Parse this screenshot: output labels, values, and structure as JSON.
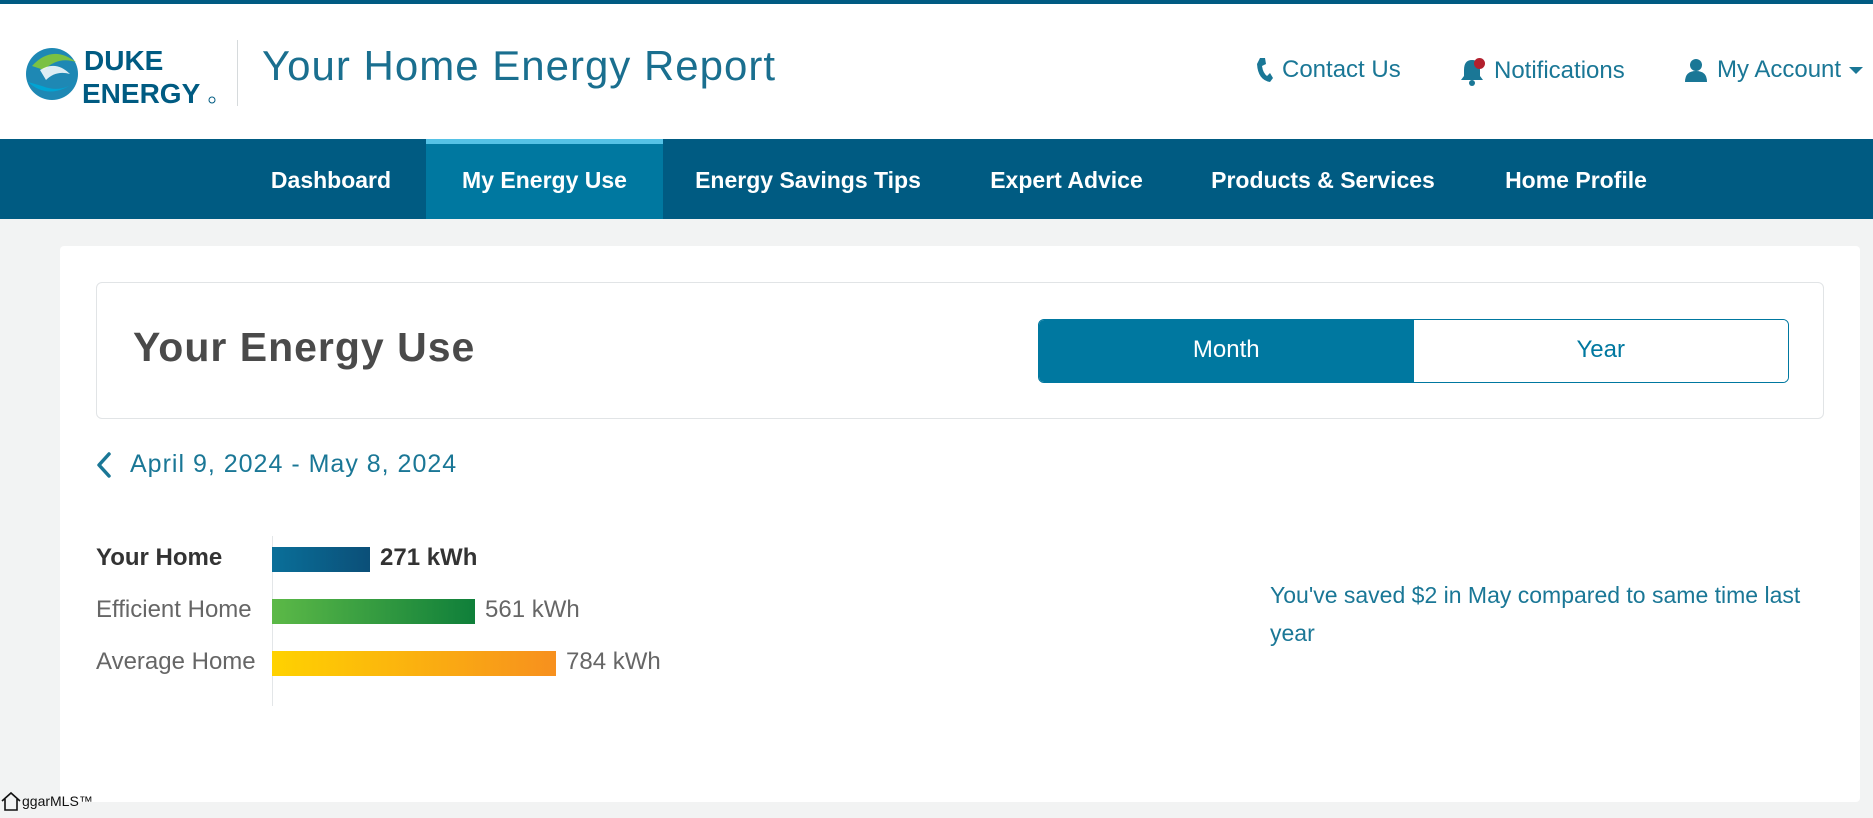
{
  "brand": {
    "logo_line1": "DUKE",
    "logo_line2": "ENERGY",
    "colors": {
      "primary": "#005b82",
      "accent": "#0078a0",
      "highlight": "#55c2e6",
      "efficient": "#1f9a47",
      "average": "#f7a11a",
      "notification": "#b3202e"
    }
  },
  "header": {
    "title": "Your Home Energy Report",
    "contact_label": "Contact Us",
    "notifications_label": "Notifications",
    "account_label": "My Account"
  },
  "nav": {
    "items": [
      {
        "label": "Dashboard"
      },
      {
        "label": "My Energy Use"
      },
      {
        "label": "Energy Savings Tips"
      },
      {
        "label": "Expert Advice"
      },
      {
        "label": "Products & Services"
      },
      {
        "label": "Home Profile"
      }
    ],
    "active": "My Energy Use"
  },
  "energy_panel": {
    "title": "Your Energy Use",
    "toggle": {
      "month_label": "Month",
      "year_label": "Year",
      "selected": "Month"
    }
  },
  "period": {
    "label": "April 9, 2024 - May 8, 2024"
  },
  "chart_data": {
    "type": "bar",
    "orientation": "horizontal",
    "categories": [
      "Your Home",
      "Efficient Home",
      "Average Home"
    ],
    "values": [
      271,
      561,
      784
    ],
    "value_labels": [
      "271 kWh",
      "561 kWh",
      "784 kWh"
    ],
    "unit": "kWh",
    "colors": [
      "#005b82",
      "#1f9a47",
      "#f7a11a"
    ]
  },
  "savings_message": "You've saved $2 in May compared to same time last year",
  "watermark": "ggarMLS™"
}
